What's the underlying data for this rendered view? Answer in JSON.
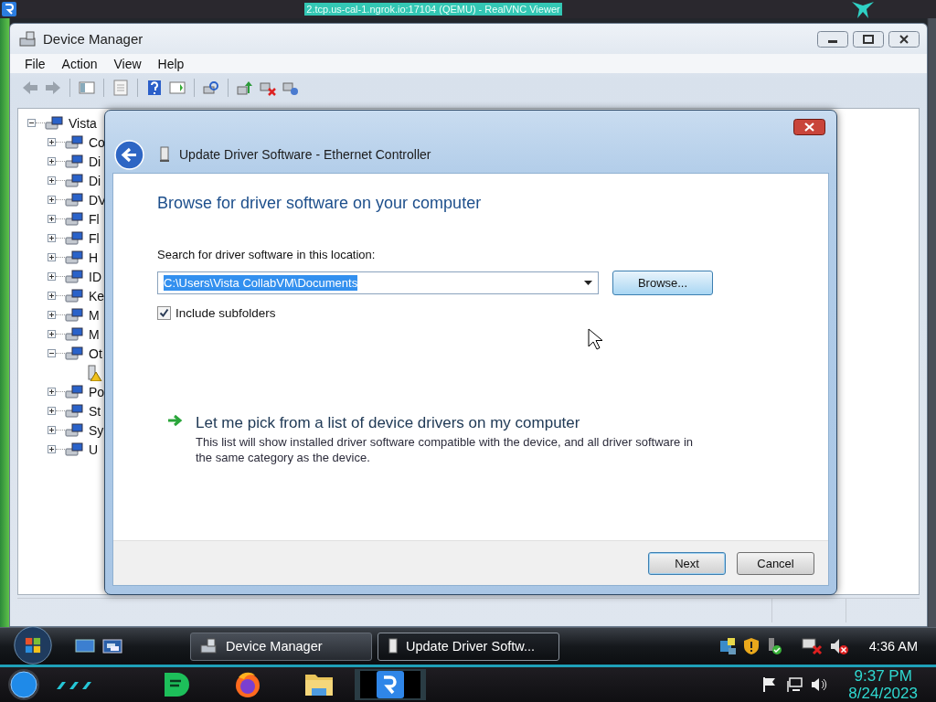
{
  "vnc_viewer": {
    "title": "2.tcp.us-cal-1.ngrok.io:17104 (QEMU) - RealVNC Viewer"
  },
  "device_manager": {
    "title": "Device Manager",
    "menu": [
      "File",
      "Action",
      "View",
      "Help"
    ],
    "tree": [
      {
        "label": "Vista",
        "expanded": true,
        "children": [
          {
            "label": "Co",
            "expanded": false
          },
          {
            "label": "Di",
            "expanded": false
          },
          {
            "label": "Di",
            "expanded": false
          },
          {
            "label": "DV",
            "expanded": false
          },
          {
            "label": "Fl",
            "expanded": false
          },
          {
            "label": "Fl",
            "expanded": false
          },
          {
            "label": "H",
            "expanded": false
          },
          {
            "label": "ID",
            "expanded": false
          },
          {
            "label": "Ke",
            "expanded": false
          },
          {
            "label": "M",
            "expanded": false
          },
          {
            "label": "M",
            "expanded": false
          },
          {
            "label": "Ot",
            "expanded": true,
            "children": [
              {
                "warning": true
              }
            ]
          },
          {
            "label": "Po",
            "expanded": false
          },
          {
            "label": "St",
            "expanded": false
          },
          {
            "label": "Sy",
            "expanded": false
          },
          {
            "label": "U",
            "expanded": false
          }
        ]
      }
    ]
  },
  "dialog": {
    "title": "Update Driver Software - Ethernet Controller",
    "heading": "Browse for driver software on your computer",
    "location_label": "Search for driver software in this location:",
    "location_value": "C:\\Users\\Vista CollabVM\\Documents",
    "value_selected": true,
    "browse_button": "Browse...",
    "include_subfolders": {
      "label": "Include subfolders",
      "checked": true
    },
    "option": {
      "title": "Let me pick from a list of device drivers on my computer",
      "description": "This list will show installed driver software compatible with the device, and all driver software in the same category as the device."
    },
    "buttons": [
      {
        "label": "Next",
        "default": true
      },
      {
        "label": "Cancel",
        "default": false
      }
    ]
  },
  "taskbar": {
    "tasks": [
      {
        "label": "Device Manager",
        "selected": false
      },
      {
        "label": "Update Driver Softw...",
        "selected": true
      }
    ],
    "clock": "4:36 AM"
  },
  "host_taskbar": {
    "apps": [
      {
        "kind": "notes",
        "selected": false
      },
      {
        "kind": "browser",
        "selected": false
      },
      {
        "kind": "folder",
        "selected": false
      },
      {
        "kind": "vnc",
        "selected": true
      }
    ],
    "time": "9:37 PM",
    "date": "8/24/2023"
  }
}
